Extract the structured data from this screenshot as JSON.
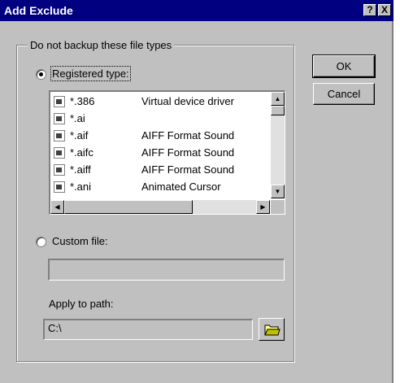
{
  "window": {
    "title": "Add Exclude",
    "help_label": "?",
    "close_label": "X"
  },
  "group": {
    "label": "Do not backup these file types"
  },
  "buttons": {
    "ok": "OK",
    "cancel": "Cancel"
  },
  "registered": {
    "label": "Registered type:",
    "selected": true
  },
  "list": {
    "items": [
      {
        "ext": "*.386",
        "desc": "Virtual device driver",
        "icon": "driver-file-icon"
      },
      {
        "ext": "*.ai",
        "desc": "",
        "icon": "sound-file-icon"
      },
      {
        "ext": "*.aif",
        "desc": "AIFF Format Sound",
        "icon": "sound-file-icon"
      },
      {
        "ext": "*.aifc",
        "desc": "AIFF Format Sound",
        "icon": "sound-file-icon"
      },
      {
        "ext": "*.aiff",
        "desc": "AIFF Format Sound",
        "icon": "sound-file-icon"
      },
      {
        "ext": "*.ani",
        "desc": "Animated Cursor",
        "icon": "sound-file-icon"
      }
    ]
  },
  "custom": {
    "label": "Custom file:",
    "selected": false,
    "value": ""
  },
  "path": {
    "label": "Apply to path:",
    "value": "C:\\"
  },
  "colors": {
    "title_bg": "#000080",
    "face": "#c0c0c0"
  }
}
